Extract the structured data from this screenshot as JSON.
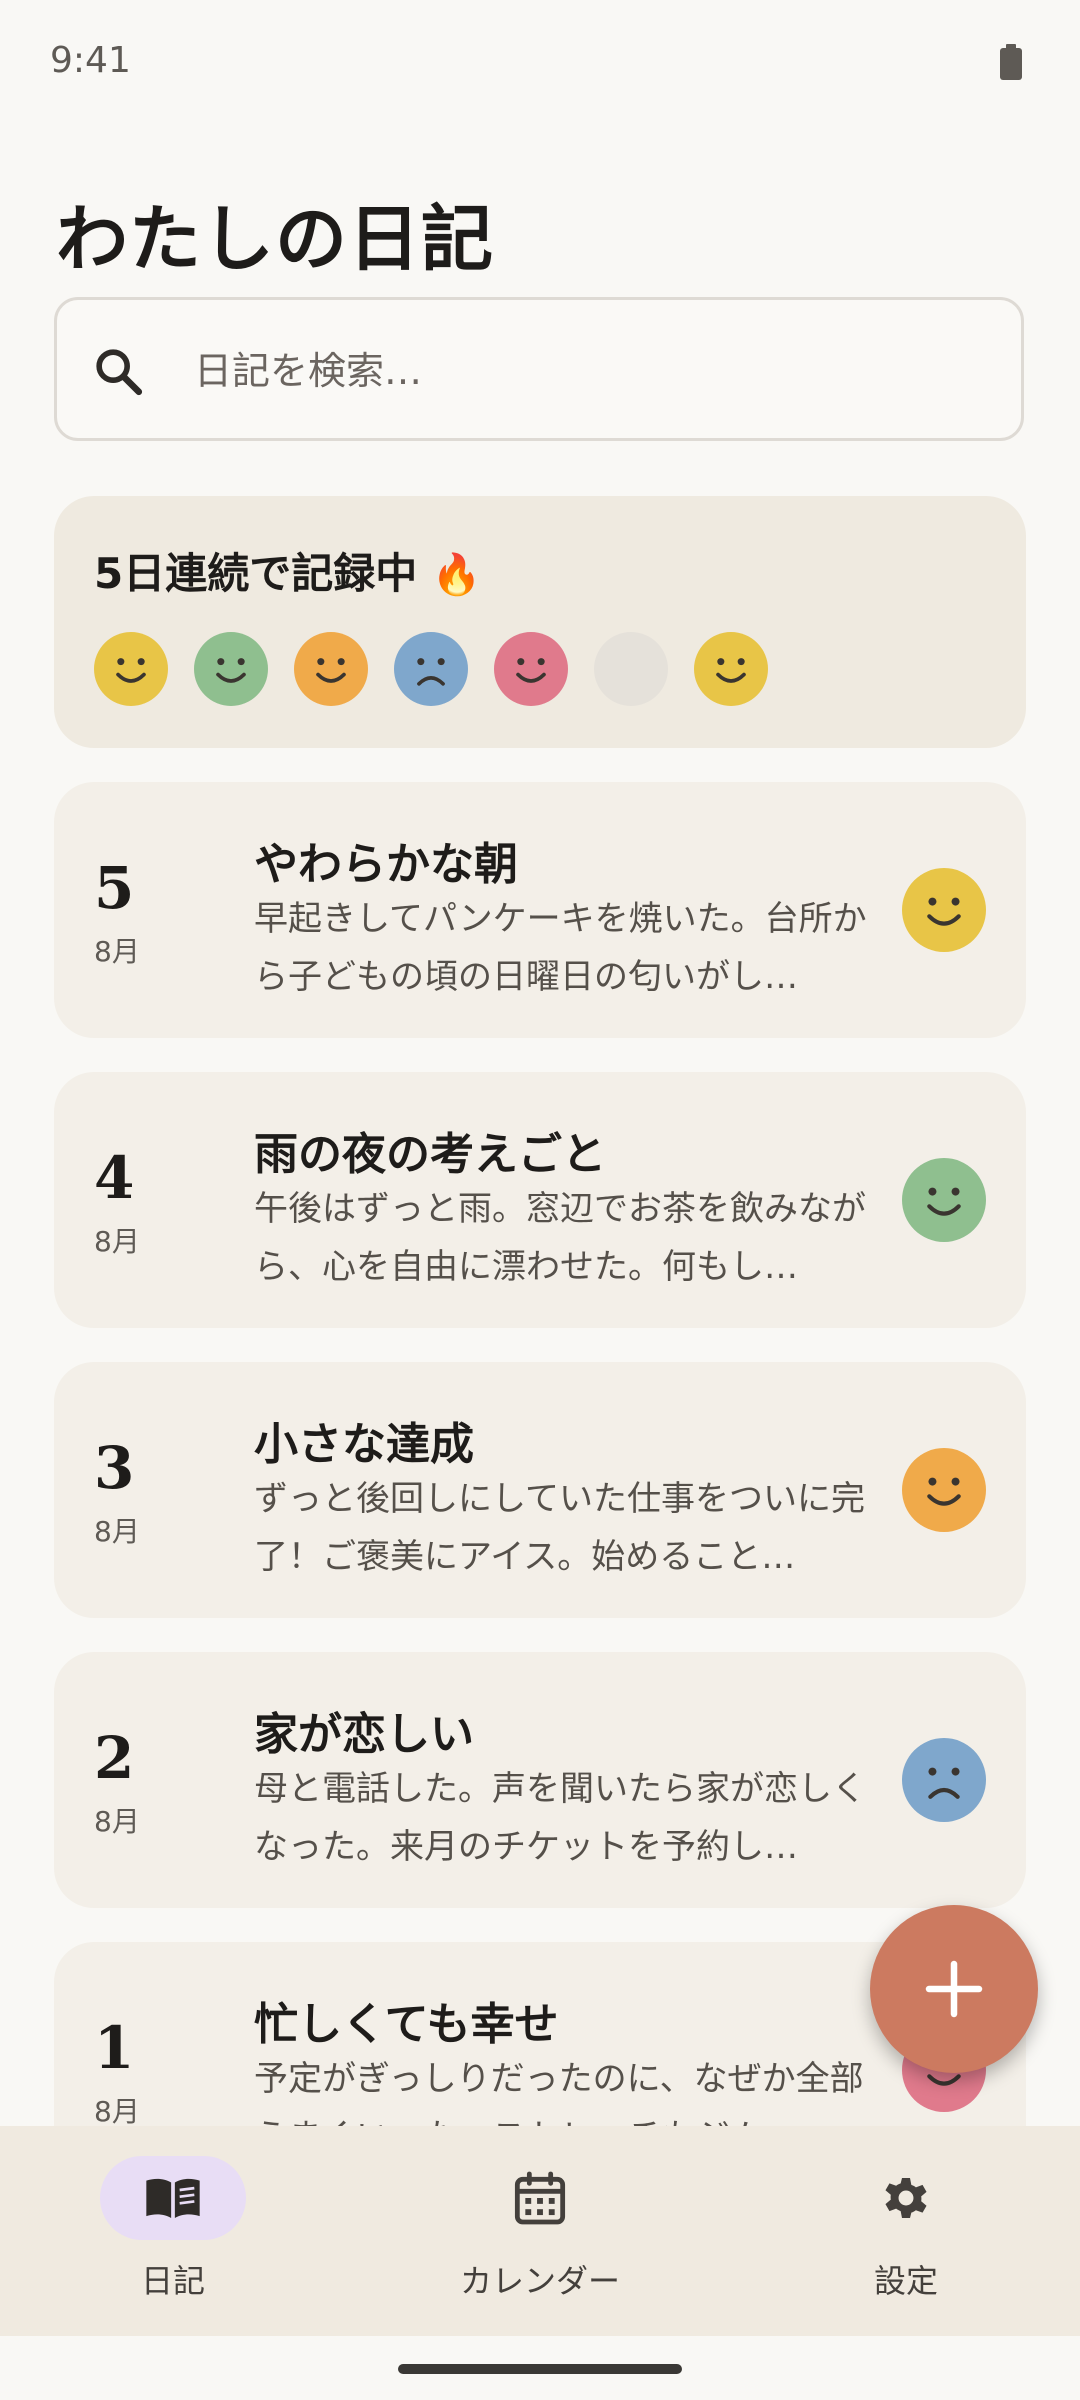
{
  "status_bar": {
    "time": "9:41",
    "battery_icon": "battery-icon"
  },
  "header": {
    "title": "わたしの日記"
  },
  "search": {
    "placeholder": "日記を検索…",
    "value": "",
    "icon": "search-icon"
  },
  "streak": {
    "label": "5日連続で記録中",
    "emoji": "🔥",
    "days": [
      {
        "mood": "happy",
        "color": "#E8C547"
      },
      {
        "mood": "happy",
        "color": "#8FBF8F"
      },
      {
        "mood": "happy",
        "color": "#F0AA4A"
      },
      {
        "mood": "sad",
        "color": "#7FA7CC"
      },
      {
        "mood": "happy",
        "color": "#E07A8C"
      },
      {
        "mood": "none",
        "color": "#E5E1DA"
      },
      {
        "mood": "happy",
        "color": "#E8C547"
      }
    ]
  },
  "entries": [
    {
      "day": "5",
      "month": "8月",
      "title": "やわらかな朝",
      "body": "早起きしてパンケーキを焼いた。台所から子どもの頃の日曜日の匂いがし…",
      "mood": "happy",
      "mood_color": "#E8C547"
    },
    {
      "day": "4",
      "month": "8月",
      "title": "雨の夜の考えごと",
      "body": "午後はずっと雨。窓辺でお茶を飲みながら、心を自由に漂わせた。何もし…",
      "mood": "happy",
      "mood_color": "#8FBF8F"
    },
    {
      "day": "3",
      "month": "8月",
      "title": "小さな達成",
      "body": "ずっと後回しにしていた仕事をついに完了！ご褒美にアイス。始めること…",
      "mood": "happy",
      "mood_color": "#F0AA4A"
    },
    {
      "day": "2",
      "month": "8月",
      "title": "家が恋しい",
      "body": "母と電話した。声を聞いたら家が恋しくなった。来月のチケットを予約し…",
      "mood": "sad",
      "mood_color": "#7FA7CC"
    },
    {
      "day": "1",
      "month": "8月",
      "title": "忙しくても幸せ",
      "body": "予定がぎっしりだったのに、なぜか全部うまくいった。ストレッチもジム…",
      "mood": "happy",
      "mood_color": "#E07A8C"
    }
  ],
  "fab": {
    "icon": "plus-icon",
    "color": "#CC7A60"
  },
  "nav": {
    "items": [
      {
        "label": "日記",
        "icon": "book-icon",
        "active": true
      },
      {
        "label": "カレンダー",
        "icon": "calendar-icon",
        "active": false
      },
      {
        "label": "設定",
        "icon": "gear-icon",
        "active": false
      }
    ]
  }
}
